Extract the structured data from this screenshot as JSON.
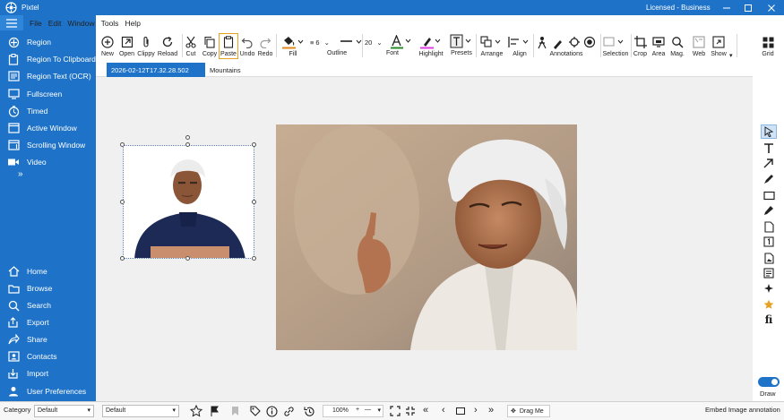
{
  "window": {
    "app_title": "Pixtel",
    "license": "Licensed - Business"
  },
  "menu": [
    "File",
    "Edit",
    "Window",
    "Tools",
    "Help"
  ],
  "sidebar": {
    "capture": [
      "Region",
      "Region To Clipboard",
      "Region Text (OCR)",
      "Fullscreen",
      "Timed",
      "Active Window",
      "Scrolling Window",
      "Video"
    ],
    "nav": [
      "Home",
      "Browse",
      "Search",
      "Export",
      "Share",
      "Contacts",
      "Import",
      "User Preferences"
    ]
  },
  "toolbar": {
    "new": "New",
    "open": "Open",
    "clippy": "Clippy",
    "reload": "Reload",
    "cut": "Cut",
    "copy": "Copy",
    "paste": "Paste",
    "undo": "Undo",
    "redo": "Redo",
    "fill": "Fill",
    "outline": "Outline",
    "outline_width": "6",
    "font": "Font",
    "font_size": "20",
    "highlight": "Highlight",
    "presets": "Presets",
    "arrange": "Arrange",
    "align": "Align",
    "annotations": "Annotations",
    "selection": "Selection",
    "crop": "Crop",
    "area": "Area",
    "mag": "Mag.",
    "web": "Web",
    "show": "Show",
    "grid": "Grid"
  },
  "tabs": [
    {
      "label": "2026-02-12T17.32.28.502",
      "active": true
    },
    {
      "label": "Mountains",
      "active": false
    }
  ],
  "right_tools": {
    "draw_label": "Draw",
    "draw_enabled": true
  },
  "status": {
    "category_label": "Category",
    "category_value": "Default",
    "preset_value": "Default",
    "zoom": "100%",
    "drag": "Drag Me",
    "embed": "Embed Image annotation"
  },
  "colors": {
    "accent": "#1e73c8",
    "fill_underline": "#e08a1e",
    "highlight_underline": "#e040e0",
    "font_underline": "#2a8a2a",
    "active_paste": "#e8a020"
  }
}
